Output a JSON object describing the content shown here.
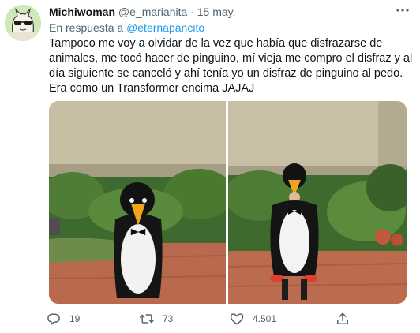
{
  "tweet": {
    "author": {
      "display_name": "Michiwoman",
      "handle": "@e_marianita"
    },
    "separator": "·",
    "date": "15 may.",
    "reply_prefix": "En respuesta a",
    "reply_to": "@eternapancito",
    "text": "Tampoco me voy a olvidar de la vez que había que disfrazarse de animales, me tocó hacer de pinguino, mí vieja me compro el disfraz y al día siguiente se canceló y ahí tenía yo un disfraz de pinguino al pedo. Era como un Transformer encima JAJAJ",
    "actions": {
      "replies": "19",
      "retweets": "73",
      "likes": "4.501"
    },
    "icons": {
      "more": "more-dots-icon",
      "reply": "reply-bubble-icon",
      "retweet": "retweet-arrows-icon",
      "like": "heart-icon",
      "share": "share-upload-icon"
    }
  },
  "colors": {
    "text": "#0f1419",
    "secondary": "#536471",
    "link": "#1d9bf0"
  }
}
